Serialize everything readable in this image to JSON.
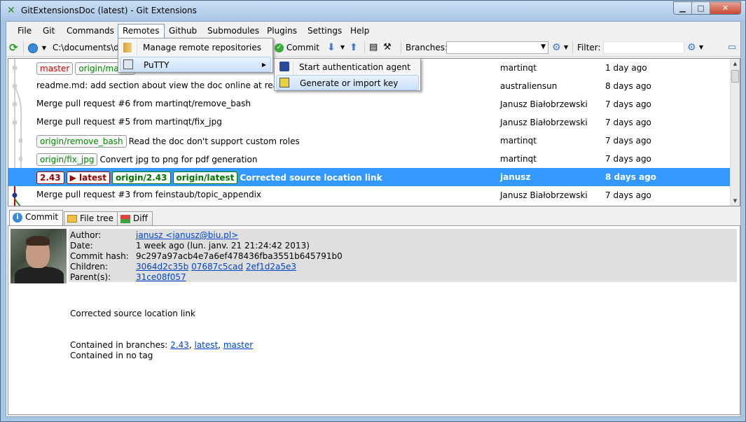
{
  "window": {
    "title": "GitExtensionsDoc (latest) - Git Extensions",
    "minimize": "0",
    "maximize": "1",
    "close": "r"
  },
  "menubar": [
    "File",
    "Git",
    "Commands",
    "Remotes",
    "Github",
    "Submodules",
    "Plugins",
    "Settings",
    "Help"
  ],
  "toolbar": {
    "path": "C:\\documents\\do",
    "commit_label": "Commit",
    "branches_label": "Branches:",
    "filter_label": "Filter:"
  },
  "remotes_menu": {
    "manage": "Manage remote repositories",
    "putty": "PuTTY",
    "putty_submenu": [
      "Start authentication agent",
      "Generate or import key"
    ]
  },
  "commits": [
    {
      "tags": [
        {
          "text": "master",
          "kind": "red"
        },
        {
          "text": "origin/maste",
          "kind": "green"
        }
      ],
      "message": "",
      "author": "martinqt",
      "date": "1 day ago",
      "selected": false
    },
    {
      "tags": [],
      "message": "readme.md: add section about view the doc online at readthedo",
      "author": "australiensun",
      "date": "8 days ago",
      "selected": false
    },
    {
      "tags": [],
      "message": "Merge pull request #6 from martinqt/remove_bash",
      "author": "Janusz Białobrzewski",
      "date": "7 days ago",
      "selected": false
    },
    {
      "tags": [],
      "message": "Merge pull request #5 from martinqt/fix_jpg",
      "author": "Janusz Białobrzewski",
      "date": "7 days ago",
      "selected": false
    },
    {
      "tags": [
        {
          "text": "origin/remove_bash",
          "kind": "green"
        }
      ],
      "message": "Read the doc don't support custom roles",
      "author": "martinqt",
      "date": "7 days ago",
      "selected": false
    },
    {
      "tags": [
        {
          "text": "origin/fix_jpg",
          "kind": "green"
        }
      ],
      "message": "Convert jpg to png for pdf generation",
      "author": "martinqt",
      "date": "7 days ago",
      "selected": false
    },
    {
      "tags": [
        {
          "text": "2.43",
          "kind": "red"
        },
        {
          "text": "▶ latest",
          "kind": "red"
        },
        {
          "text": "origin/2.43",
          "kind": "green"
        },
        {
          "text": "origin/latest",
          "kind": "green"
        }
      ],
      "message": "Corrected source location link",
      "author": "janusz",
      "date": "8 days ago",
      "selected": true
    },
    {
      "tags": [],
      "message": "Merge pull request #3 from feinstaub/topic_appendix",
      "author": "Janusz Białobrzewski",
      "date": "7 days ago",
      "selected": false
    }
  ],
  "tabs": [
    "Commit",
    "File tree",
    "Diff"
  ],
  "commit_info": {
    "author_label": "Author:",
    "author_value": "janusz <janusz@biu.pl>",
    "date_label": "Date:",
    "date_value": "1 week ago (lun. janv. 21 21:24:42 2013)",
    "hash_label": "Commit hash:",
    "hash_value": "9c297a97acb4e7a6ef478436fba3551b645791b0",
    "children_label": "Children:",
    "children": [
      "3064d2c35b",
      "07687c5cad",
      "2ef1d2a5e3"
    ],
    "parents_label": "Parent(s):",
    "parents": [
      "31ce08f057"
    ],
    "message": "Corrected source location link",
    "contained_branches_label": "Contained in branches:",
    "contained_branches": [
      "2.43",
      "latest",
      "master"
    ],
    "contained_tags": "Contained in no tag"
  },
  "colors": {
    "selection": "#3399ff",
    "tag_local": "#cc0000",
    "tag_remote": "#008800",
    "link": "#0044cc"
  }
}
